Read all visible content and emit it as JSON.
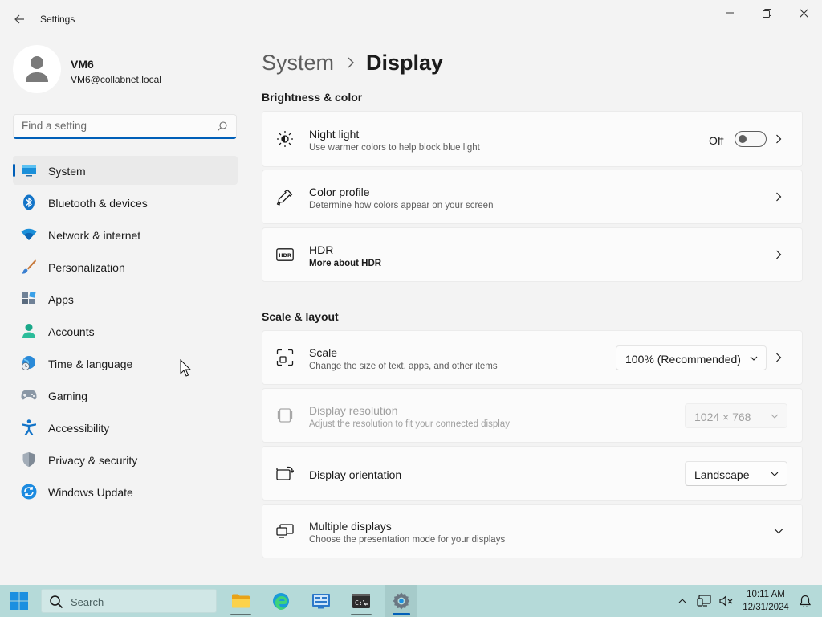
{
  "window": {
    "title": "Settings"
  },
  "user": {
    "name": "VM6",
    "email": "VM6@collabnet.local"
  },
  "search": {
    "placeholder": "Find a setting"
  },
  "nav": [
    {
      "label": "System",
      "icon": "system-icon",
      "active": true
    },
    {
      "label": "Bluetooth & devices",
      "icon": "bluetooth-icon"
    },
    {
      "label": "Network & internet",
      "icon": "wifi-icon"
    },
    {
      "label": "Personalization",
      "icon": "brush-icon"
    },
    {
      "label": "Apps",
      "icon": "apps-icon"
    },
    {
      "label": "Accounts",
      "icon": "accounts-icon"
    },
    {
      "label": "Time & language",
      "icon": "globe-clock-icon"
    },
    {
      "label": "Gaming",
      "icon": "gamepad-icon"
    },
    {
      "label": "Accessibility",
      "icon": "accessibility-icon"
    },
    {
      "label": "Privacy & security",
      "icon": "shield-icon"
    },
    {
      "label": "Windows Update",
      "icon": "update-icon"
    }
  ],
  "breadcrumb": {
    "parent": "System",
    "current": "Display"
  },
  "sections": {
    "brightness": "Brightness & color",
    "scale_layout": "Scale & layout"
  },
  "cards": {
    "night_light": {
      "title": "Night light",
      "subtitle": "Use warmer colors to help block blue light",
      "state_label": "Off",
      "on": false
    },
    "color_profile": {
      "title": "Color profile",
      "subtitle": "Determine how colors appear on your screen"
    },
    "hdr": {
      "title": "HDR",
      "subtitle": "More about HDR"
    },
    "scale": {
      "title": "Scale",
      "subtitle": "Change the size of text, apps, and other items",
      "value": "100% (Recommended)"
    },
    "resolution": {
      "title": "Display resolution",
      "subtitle": "Adjust the resolution to fit your connected display",
      "value": "1024 × 768",
      "disabled": true
    },
    "orientation": {
      "title": "Display orientation",
      "value": "Landscape"
    },
    "multiple": {
      "title": "Multiple displays",
      "subtitle": "Choose the presentation mode for your displays"
    }
  },
  "taskbar": {
    "search_label": "Search",
    "apps": [
      "file-explorer-icon",
      "edge-icon",
      "control-panel-icon",
      "command-prompt-icon",
      "settings-gear-icon"
    ],
    "time": "10:11 AM",
    "date": "12/31/2024"
  },
  "colors": {
    "accent": "#005fb8",
    "taskbar": "#b5dad9",
    "window_bg": "#f3f3f3"
  }
}
